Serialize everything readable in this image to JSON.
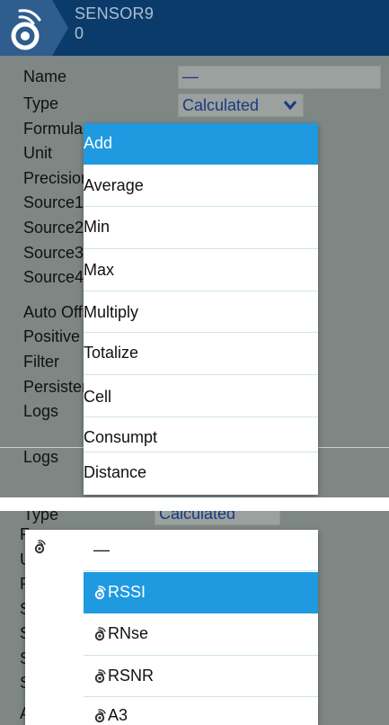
{
  "header": {
    "title_line1": "SENSOR9",
    "title_line2": "0",
    "icon": "sensor-icon"
  },
  "form": {
    "rows": [
      {
        "label": "Name"
      },
      {
        "label": "Type"
      },
      {
        "label": "Formula"
      },
      {
        "label": "Unit"
      },
      {
        "label": "Precision"
      },
      {
        "label": "Source1"
      },
      {
        "label": "Source2"
      },
      {
        "label": "Source3"
      },
      {
        "label": "Source4"
      },
      {
        "label": "Auto Offset"
      },
      {
        "label": "Positive"
      },
      {
        "label": "Filter"
      },
      {
        "label": "Persistent"
      },
      {
        "label": "Logs"
      },
      {
        "label": "Logs"
      }
    ],
    "name_value": "—",
    "type_value": "Calculated"
  },
  "formula_menu": {
    "items": [
      "Add",
      "Average",
      "Min",
      "Max",
      "Multiply",
      "Totalize",
      "Cell",
      "Consumpt",
      "Distance"
    ],
    "selected": "Add"
  },
  "bottom": {
    "type_label": "Type",
    "type_value": "Calculated",
    "side_letters": [
      "F",
      "U",
      "P",
      "S",
      "S",
      "S",
      "S",
      "A"
    ],
    "source_menu": {
      "items": [
        {
          "label": "—",
          "icon": ""
        },
        {
          "label": "RSSI",
          "icon": "sensor-icon"
        },
        {
          "label": "RNse",
          "icon": "sensor-icon"
        },
        {
          "label": "RSNR",
          "icon": "sensor-icon"
        },
        {
          "label": "A3",
          "icon": "sensor-icon"
        }
      ],
      "selected": "RSSI"
    }
  },
  "colors": {
    "header_bg": "#0b3b6a",
    "panel_bg": "#7e8784",
    "selected_bg": "#1f9ae0",
    "value_text": "#1a3a80"
  }
}
